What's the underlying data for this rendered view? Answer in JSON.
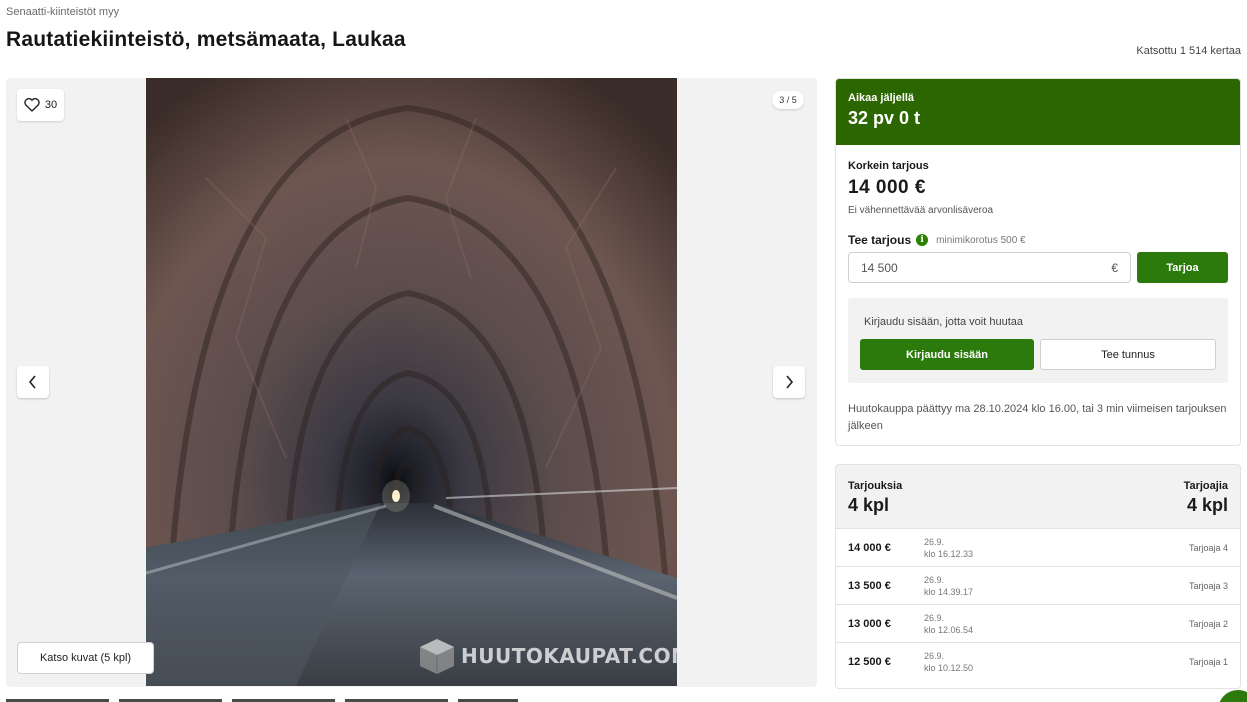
{
  "header": {
    "seller": "Senaatti-kiinteistöt myy",
    "title": "Rautatiekiinteistö, metsämaata, Laukaa",
    "views": "Katsottu 1 514 kertaa"
  },
  "gallery": {
    "favorites_count": "30",
    "counter": "3 / 5",
    "view_images_label": "Katso kuvat (5 kpl)",
    "watermark_text": "HUUTOKAUPAT.COM",
    "icons": [
      "heart-icon",
      "chevron-left-icon",
      "chevron-right-icon"
    ]
  },
  "auction": {
    "time_left_label": "Aikaa jäljellä",
    "time_left_value": "32 pv 0 t",
    "highest_bid_label": "Korkein tarjous",
    "highest_bid_value": "14 000 €",
    "vat_note": "Ei vähennettävää arvonlisäveroa",
    "make_bid_label": "Tee tarjous",
    "min_raise": "minimikorotus 500 €",
    "bid_input_value": "14 500",
    "currency_symbol": "€",
    "bid_button": "Tarjoa",
    "login_prompt": "Kirjaudu sisään, jotta voit huutaa",
    "login_button": "Kirjaudu sisään",
    "register_button": "Tee tunnus",
    "end_note": "Huutokauppa päättyy ma 28.10.2024 klo 16.00, tai 3 min viimeisen tarjouksen jälkeen",
    "accent_color": "#2b6600",
    "button_color": "#2b7a0b"
  },
  "bids": {
    "count_label": "Tarjouksia",
    "count_value": "4 kpl",
    "bidders_label": "Tarjoajia",
    "bidders_value": "4 kpl",
    "rows": [
      {
        "amount": "14 000 €",
        "date": "26.9.",
        "time": "klo 16.12.33",
        "bidder": "Tarjoaja 4"
      },
      {
        "amount": "13 500 €",
        "date": "26.9.",
        "time": "klo 14.39.17",
        "bidder": "Tarjoaja 3"
      },
      {
        "amount": "13 000 €",
        "date": "26.9.",
        "time": "klo 12.06.54",
        "bidder": "Tarjoaja 2"
      },
      {
        "amount": "12 500 €",
        "date": "26.9.",
        "time": "klo 10.12.50",
        "bidder": "Tarjoaja 1"
      }
    ]
  }
}
